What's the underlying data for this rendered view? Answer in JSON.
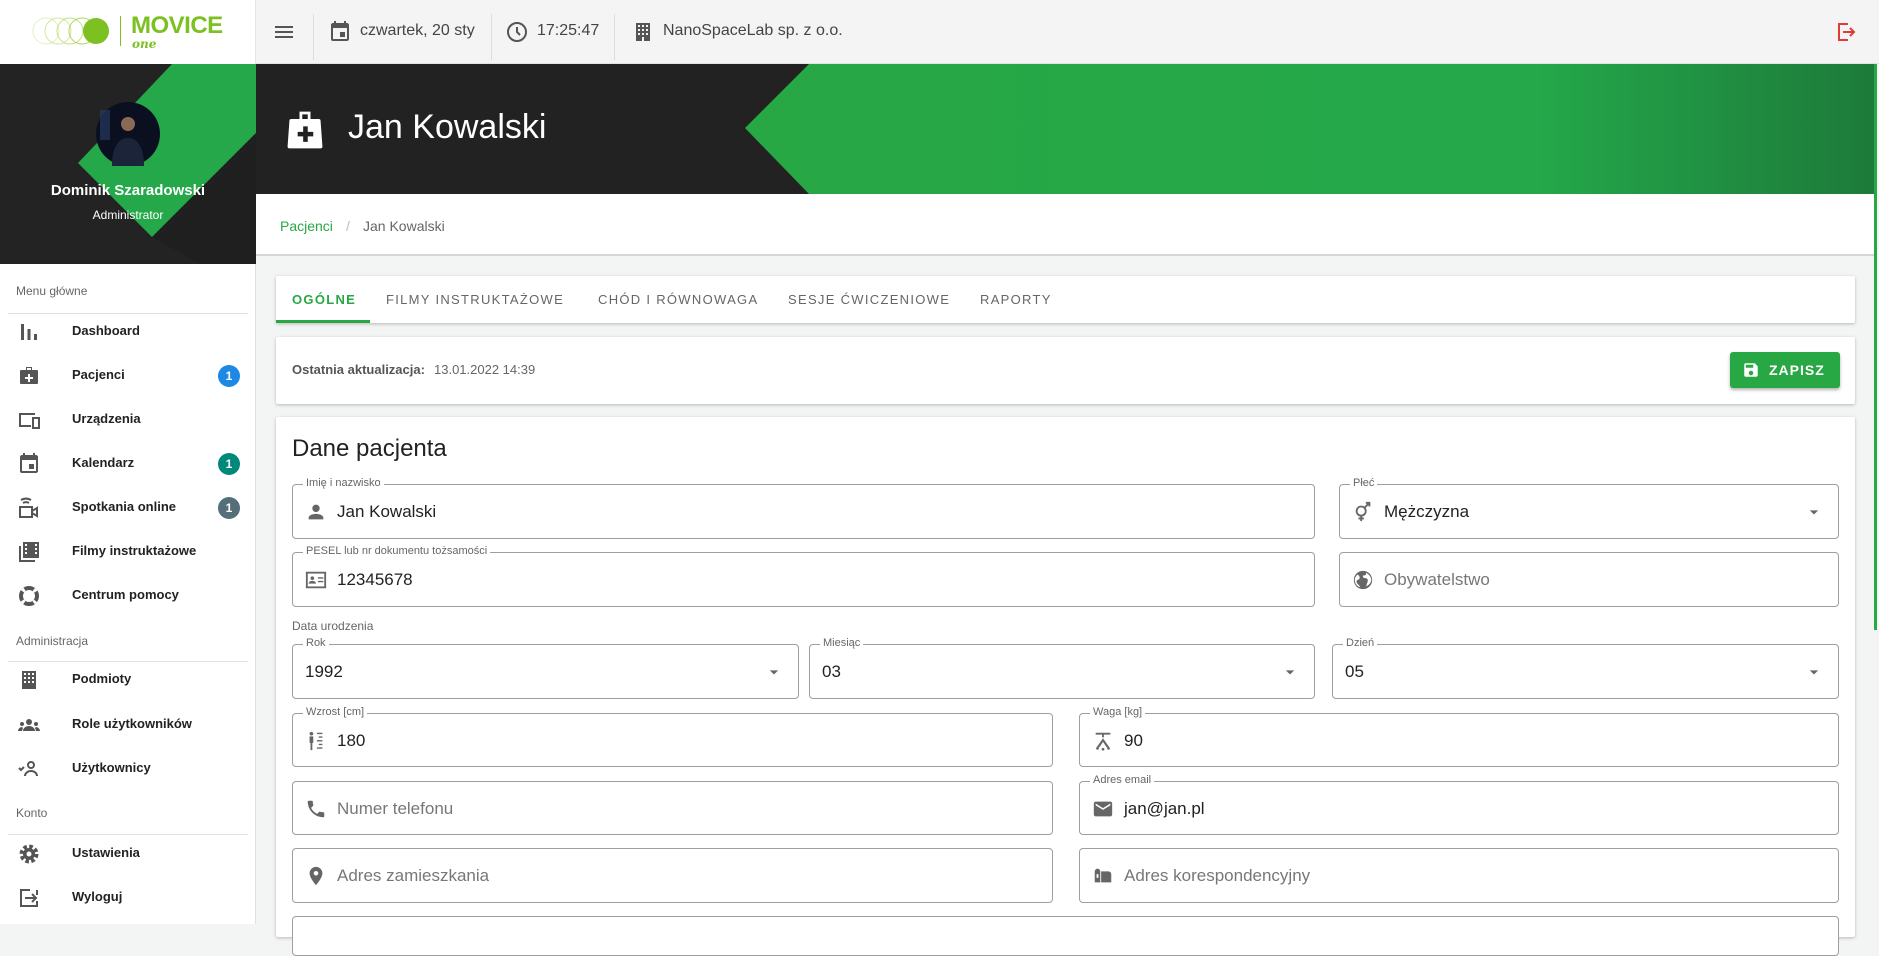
{
  "brand": {
    "name": "MOVICE",
    "sub": "one"
  },
  "topbar": {
    "date": "czwartek, 20 sty",
    "time": "17:25:47",
    "company": "NanoSpaceLab sp. z o.o."
  },
  "user": {
    "name": "Dominik Szaradowski",
    "role": "Administrator"
  },
  "sidebar": {
    "sections": [
      "Menu główne",
      "Administracja",
      "Konto"
    ],
    "items": [
      {
        "label": "Dashboard",
        "icon": "bar-chart-icon"
      },
      {
        "label": "Pacjenci",
        "icon": "medical-bag-icon",
        "badge": "1",
        "badge_color": "#1e88e5"
      },
      {
        "label": "Urządzenia",
        "icon": "devices-icon"
      },
      {
        "label": "Kalendarz",
        "icon": "calendar-icon",
        "badge": "1",
        "badge_color": "#00897b"
      },
      {
        "label": "Spotkania online",
        "icon": "video-call-icon",
        "badge": "1",
        "badge_color": "#546e7a"
      },
      {
        "label": "Filmy instruktażowe",
        "icon": "video-library-icon"
      },
      {
        "label": "Centrum pomocy",
        "icon": "lifebuoy-icon"
      },
      {
        "label": "Podmioty",
        "icon": "building-icon"
      },
      {
        "label": "Role użytkowników",
        "icon": "group-icon"
      },
      {
        "label": "Użytkownicy",
        "icon": "user-check-icon"
      },
      {
        "label": "Ustawienia",
        "icon": "gear-icon"
      },
      {
        "label": "Wyloguj",
        "icon": "logout-icon"
      }
    ]
  },
  "header": {
    "title": "Jan Kowalski"
  },
  "breadcrumb": {
    "parent": "Pacjenci",
    "separator": "/",
    "current": "Jan Kowalski"
  },
  "tabs": [
    "OGÓLNE",
    "FILMY INSTRUKTAŻOWE",
    "CHÓD I RÓWNOWAGA",
    "SESJE ĆWICZENIOWE",
    "RAPORTY"
  ],
  "update": {
    "label": "Ostatnia aktualizacja:",
    "value": "13.01.2022 14:39"
  },
  "save_label": "ZAPISZ",
  "form": {
    "title": "Dane pacjenta",
    "birth_label": "Data urodzenia",
    "name": {
      "label": "Imię i nazwisko",
      "value": "Jan Kowalski"
    },
    "gender": {
      "label": "Płeć",
      "value": "Mężczyzna"
    },
    "pesel": {
      "label": "PESEL lub nr dokumentu tożsamości",
      "value": "12345678"
    },
    "citizenship": {
      "placeholder": "Obywatelstwo"
    },
    "year": {
      "label": "Rok",
      "value": "1992"
    },
    "month": {
      "label": "Miesiąc",
      "value": "03"
    },
    "day": {
      "label": "Dzień",
      "value": "05"
    },
    "height": {
      "label": "Wzrost [cm]",
      "value": "180"
    },
    "weight": {
      "label": "Waga [kg]",
      "value": "90"
    },
    "phone": {
      "placeholder": "Numer telefonu"
    },
    "email": {
      "label": "Adres email",
      "value": "jan@jan.pl"
    },
    "address": {
      "placeholder": "Adres zamieszkania"
    },
    "mail_address": {
      "placeholder": "Adres korespondencyjny"
    }
  },
  "colors": {
    "accent": "#28a745",
    "dark": "#222222"
  }
}
